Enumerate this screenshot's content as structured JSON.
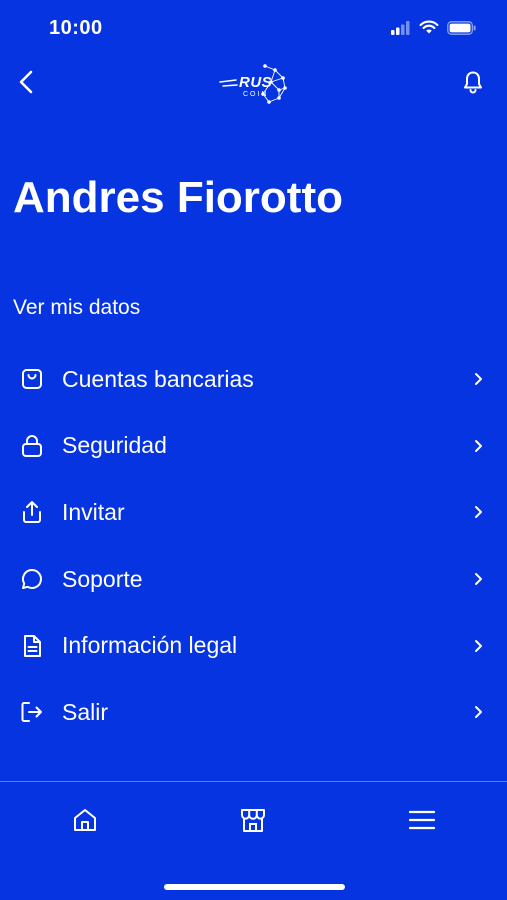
{
  "status_bar": {
    "time": "10:00"
  },
  "header": {
    "logo_text": "RUS",
    "logo_subtext": "COIN"
  },
  "profile": {
    "name": "Andres Fiorotto",
    "view_data_link": "Ver mis datos"
  },
  "menu": {
    "items": [
      {
        "label": "Cuentas bancarias",
        "icon": "bag-icon"
      },
      {
        "label": "Seguridad",
        "icon": "lock-icon"
      },
      {
        "label": "Invitar",
        "icon": "share-icon"
      },
      {
        "label": "Soporte",
        "icon": "chat-bubble-icon"
      },
      {
        "label": "Información legal",
        "icon": "document-icon"
      },
      {
        "label": "Salir",
        "icon": "logout-icon"
      }
    ]
  },
  "tab_bar": {
    "tabs": [
      {
        "name": "home",
        "icon": "home-icon"
      },
      {
        "name": "store",
        "icon": "store-icon"
      },
      {
        "name": "menu",
        "icon": "hamburger-menu-icon"
      }
    ]
  },
  "colors": {
    "background": "#0534e0",
    "foreground": "#ffffff"
  }
}
